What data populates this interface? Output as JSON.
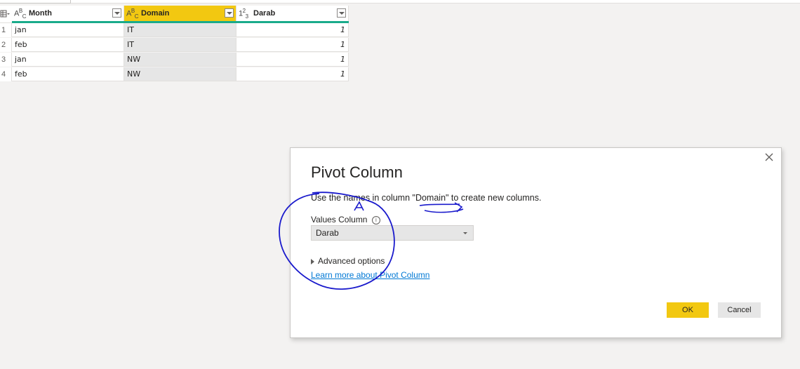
{
  "grid": {
    "columns": [
      {
        "type_icon": "ABC",
        "name": "Month",
        "selected": false
      },
      {
        "type_icon": "ABC",
        "name": "Domain",
        "selected": true
      },
      {
        "type_icon": "123",
        "name": "Darab",
        "selected": false
      }
    ],
    "rows": [
      {
        "num": "1",
        "month": "jan",
        "domain": "IT",
        "darab": "1"
      },
      {
        "num": "2",
        "month": "feb",
        "domain": "IT",
        "darab": "1"
      },
      {
        "num": "3",
        "month": "jan",
        "domain": "NW",
        "darab": "1"
      },
      {
        "num": "4",
        "month": "feb",
        "domain": "NW",
        "darab": "1"
      }
    ]
  },
  "dialog": {
    "title": "Pivot Column",
    "description": "Use the names in column \"Domain\" to create new columns.",
    "values_label": "Values Column",
    "values_selected": "Darab",
    "advanced_label": "Advanced options",
    "learn_more": "Learn more about Pivot Column",
    "ok_label": "OK",
    "cancel_label": "Cancel"
  },
  "colors": {
    "accent": "#f2c811",
    "quality_bar": "#1aab8b",
    "link": "#0078d4",
    "annotation_ink": "#1a1acc"
  },
  "icons": [
    "table-menu-icon",
    "text-type-icon",
    "number-type-icon",
    "dropdown-icon",
    "close-icon",
    "info-icon",
    "expand-triangle-icon"
  ]
}
